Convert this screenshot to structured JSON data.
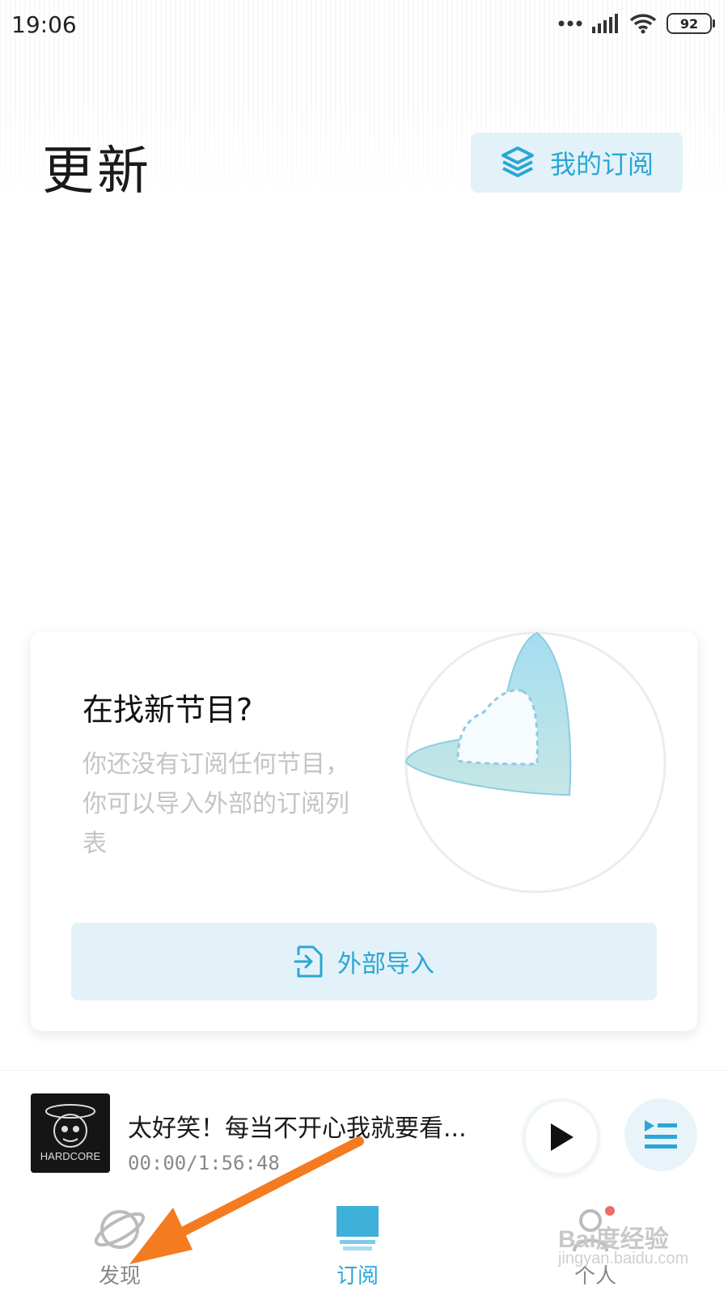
{
  "status_bar": {
    "time": "19:06",
    "battery": "92",
    "icons": [
      "dots-icon",
      "signal-icon",
      "wifi-icon",
      "battery-icon"
    ]
  },
  "header": {
    "title": "更新",
    "my_subscriptions_label": "我的订阅"
  },
  "empty_card": {
    "title": "在找新节目?",
    "description": "你还没有订阅任何节目，你可以导入外部的订阅列表",
    "import_label": "外部导入"
  },
  "player": {
    "title": "太好笑！每当不开心我就要看...",
    "time": "00:00/1:56:48",
    "cover_text": "HARDCORE"
  },
  "tabbar": {
    "items": [
      {
        "label": "发现",
        "icon": "planet-icon",
        "active": false
      },
      {
        "label": "订阅",
        "icon": "subscribe-icon",
        "active": true
      },
      {
        "label": "个人",
        "icon": "person-icon",
        "active": false
      }
    ]
  },
  "watermark": {
    "text": "Bai度经验",
    "url": "jingyan.baidu.com"
  },
  "colors": {
    "accent": "#2aa7d4",
    "accent_bg": "#e3f2f9",
    "arrow": "#f47b20"
  }
}
